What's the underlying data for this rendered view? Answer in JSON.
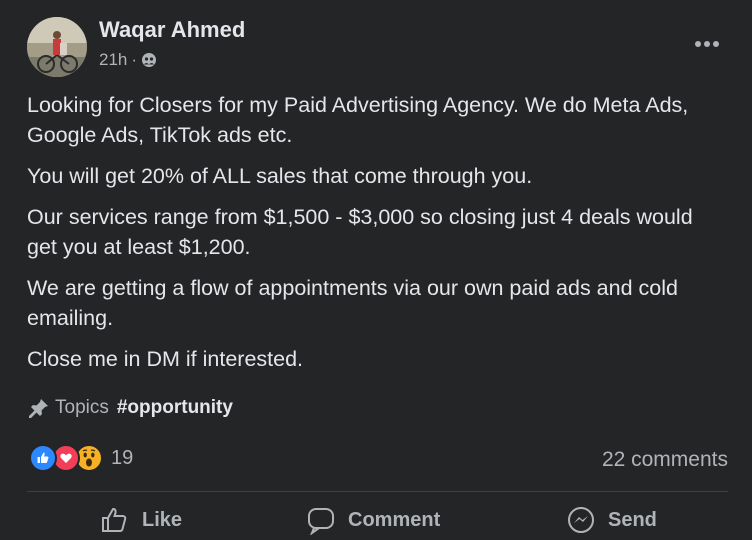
{
  "post": {
    "author": "Waqar Ahmed",
    "time": "21h",
    "separator": "·",
    "audience_icon": "friends-icon",
    "paragraphs": [
      "Looking for Closers for my Paid Advertising Agency. We do Meta Ads, Google Ads, TikTok ads etc.",
      "You will get 20% of ALL sales that come through you.",
      "Our services range from $1,500 - $3,000 so closing just 4 deals would get you at least $1,200.",
      "We are getting a flow of appointments via our own paid ads and cold emailing.",
      "Close me in DM if interested."
    ],
    "topics_label": "Topics",
    "topic_tag": "#opportunity"
  },
  "engagement": {
    "reaction_icons": [
      "like-icon",
      "love-icon",
      "wow-icon"
    ],
    "reaction_count": "19",
    "comments": "22 comments"
  },
  "actions": {
    "like": "Like",
    "comment": "Comment",
    "send": "Send"
  },
  "colors": {
    "background": "#242526",
    "text": "#e4e6eb",
    "secondary_text": "#b0b3b8",
    "like": "#2d88ff",
    "love": "#f33e58",
    "wow": "#f7b125"
  }
}
